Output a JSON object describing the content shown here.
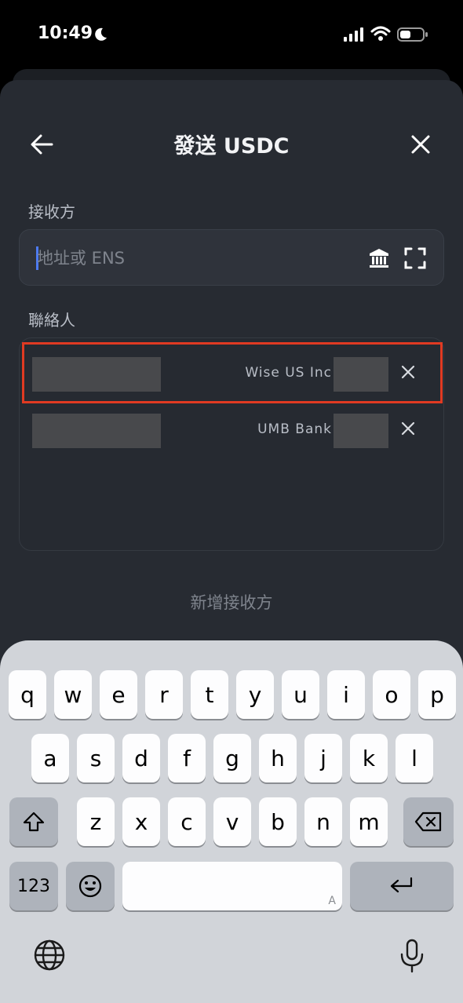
{
  "status_bar": {
    "time": "10:49",
    "moon_icon": "moon-icon",
    "signal_icon": "cellular-signal-icon",
    "wifi_icon": "wifi-icon",
    "battery_icon": "battery-icon"
  },
  "header": {
    "title": "發送 USDC",
    "back_icon": "arrow-left-icon",
    "close_icon": "close-icon"
  },
  "recipient": {
    "label": "接收方",
    "placeholder": "地址或 ENS",
    "value": "",
    "bank_icon": "bank-icon",
    "scan_icon": "scan-icon"
  },
  "contacts": {
    "label": "聯絡人",
    "items": [
      {
        "bank": "Wise US Inc"
      },
      {
        "bank": "UMB Bank"
      }
    ]
  },
  "add_recipient": "新增接收方",
  "keyboard": {
    "row1": [
      "q",
      "w",
      "e",
      "r",
      "t",
      "y",
      "u",
      "i",
      "o",
      "p"
    ],
    "row2": [
      "a",
      "s",
      "d",
      "f",
      "g",
      "h",
      "j",
      "k",
      "l"
    ],
    "row3": [
      "z",
      "x",
      "c",
      "v",
      "b",
      "n",
      "m"
    ],
    "numbers_label": "123",
    "space_hint": "A",
    "emoji_icon": "emoji-icon",
    "shift_icon": "shift-icon",
    "delete_icon": "backspace-icon",
    "return_icon": "return-icon",
    "globe_icon": "globe-icon",
    "mic_icon": "microphone-icon"
  },
  "colors": {
    "sheet": "#272b32",
    "accent_caret": "#4d7bf3",
    "highlight": "#e03a22",
    "keyboard": "#d1d4d9"
  }
}
